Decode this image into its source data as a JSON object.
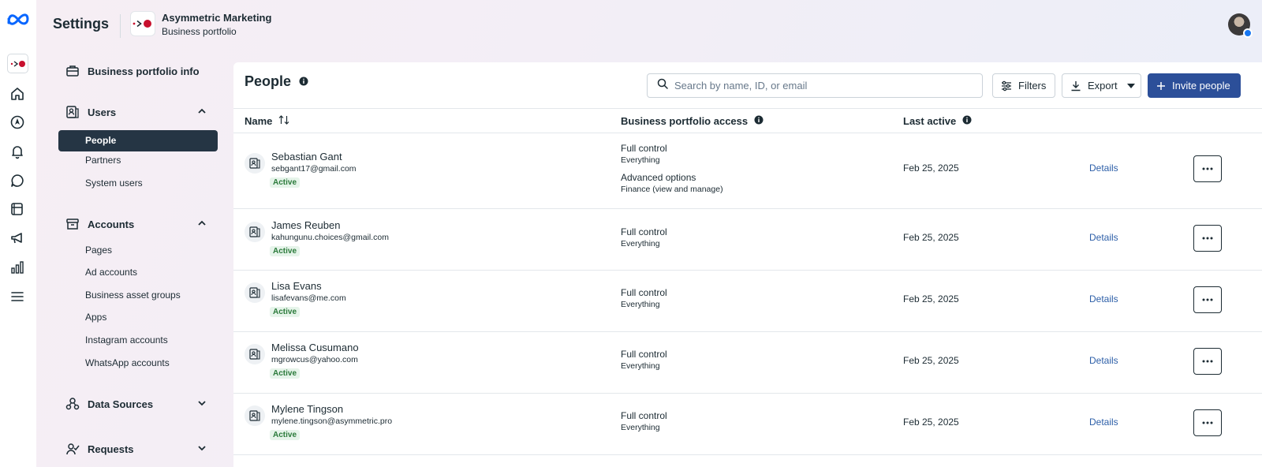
{
  "header": {
    "title": "Settings",
    "portfolio_name": "Asymmetric Marketing",
    "portfolio_type": "Business portfolio"
  },
  "rail": {
    "icons": [
      "meta-logo-icon",
      "portfolio-icon",
      "home-icon",
      "compass-icon",
      "bell-icon",
      "chat-icon",
      "pages-icon",
      "megaphone-icon",
      "bar-chart-icon",
      "menu-icon"
    ]
  },
  "nav": {
    "business_info": "Business portfolio info",
    "users": {
      "label": "Users",
      "items": [
        "People",
        "Partners",
        "System users"
      ],
      "active": "People"
    },
    "accounts": {
      "label": "Accounts",
      "items": [
        "Pages",
        "Ad accounts",
        "Business asset groups",
        "Apps",
        "Instagram accounts",
        "WhatsApp accounts"
      ]
    },
    "data_sources": "Data Sources",
    "requests": "Requests"
  },
  "main": {
    "title": "People",
    "search_placeholder": "Search by name, ID, or email",
    "filters_label": "Filters",
    "export_label": "Export",
    "invite_label": "Invite people",
    "columns": {
      "name": "Name",
      "access": "Business portfolio access",
      "last_active": "Last active"
    },
    "rows": [
      {
        "name": "Sebastian Gant",
        "email": "sebgant17@gmail.com",
        "status": "Active",
        "access": "Full control",
        "access_sub": "Everything",
        "extra": "Advanced options",
        "extra_sub": "Finance (view and manage)",
        "last_active": "Feb 25, 2025",
        "details": "Details"
      },
      {
        "name": "James Reuben",
        "email": "kahungunu.choices@gmail.com",
        "status": "Active",
        "access": "Full control",
        "access_sub": "Everything",
        "last_active": "Feb 25, 2025",
        "details": "Details"
      },
      {
        "name": "Lisa Evans",
        "email": "lisafevans@me.com",
        "status": "Active",
        "access": "Full control",
        "access_sub": "Everything",
        "last_active": "Feb 25, 2025",
        "details": "Details"
      },
      {
        "name": "Melissa Cusumano",
        "email": "mgrowcus@yahoo.com",
        "status": "Active",
        "access": "Full control",
        "access_sub": "Everything",
        "last_active": "Feb 25, 2025",
        "details": "Details"
      },
      {
        "name": "Mylene Tingson",
        "email": "mylene.tingson@asymmetric.pro",
        "status": "Active",
        "access": "Full control",
        "access_sub": "Everything",
        "last_active": "Feb 25, 2025",
        "details": "Details"
      }
    ]
  },
  "colors": {
    "primary": "#2c4f99",
    "active_nav": "#253544",
    "link": "#2d5fa8",
    "status_green": "#2a7a3a",
    "meta_blue": "#0866ff",
    "portfolio_red": "#c8102e"
  }
}
